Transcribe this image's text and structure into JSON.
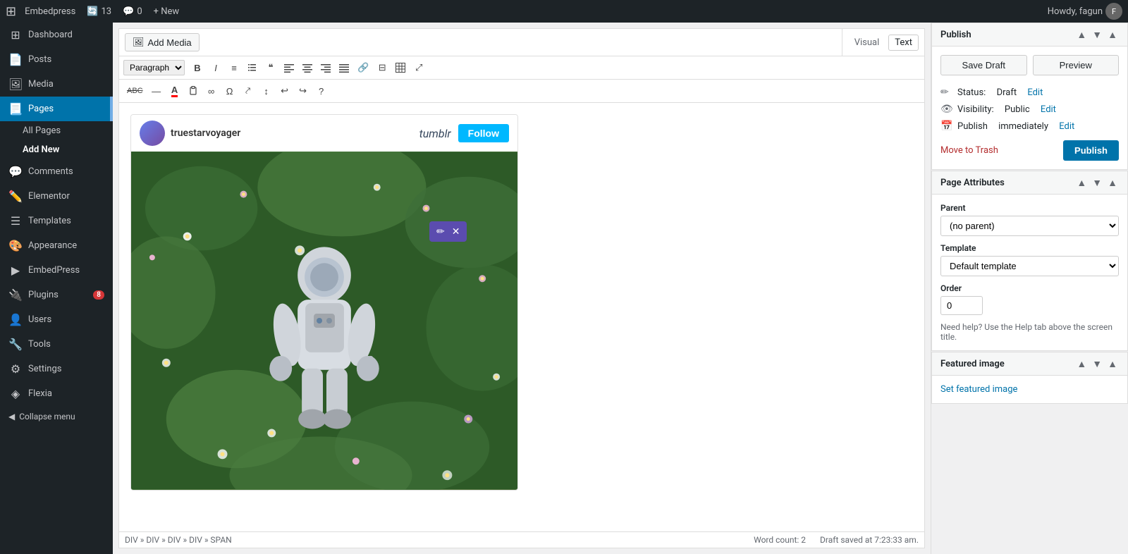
{
  "adminbar": {
    "logo": "⊞",
    "site_name": "Embedpress",
    "updates_count": "13",
    "comments_count": "0",
    "new_label": "+ New",
    "howdy": "Howdy, fagun"
  },
  "sidebar": {
    "items": [
      {
        "id": "dashboard",
        "icon": "⊞",
        "label": "Dashboard"
      },
      {
        "id": "posts",
        "icon": "📄",
        "label": "Posts"
      },
      {
        "id": "media",
        "icon": "🖼",
        "label": "Media"
      },
      {
        "id": "pages",
        "icon": "📃",
        "label": "Pages",
        "active": true
      },
      {
        "id": "comments",
        "icon": "💬",
        "label": "Comments"
      },
      {
        "id": "elementor",
        "icon": "✏️",
        "label": "Elementor"
      },
      {
        "id": "templates",
        "icon": "☰",
        "label": "Templates"
      },
      {
        "id": "appearance",
        "icon": "🎨",
        "label": "Appearance"
      },
      {
        "id": "embedpress",
        "icon": "▶",
        "label": "EmbedPress"
      },
      {
        "id": "plugins",
        "icon": "🔌",
        "label": "Plugins",
        "badge": "8"
      },
      {
        "id": "users",
        "icon": "👤",
        "label": "Users"
      },
      {
        "id": "tools",
        "icon": "🔧",
        "label": "Tools"
      },
      {
        "id": "settings",
        "icon": "⚙",
        "label": "Settings"
      },
      {
        "id": "flexia",
        "icon": "◈",
        "label": "Flexia"
      }
    ],
    "pages_subitems": [
      {
        "label": "All Pages"
      },
      {
        "label": "Add New",
        "active": true
      }
    ],
    "collapse_label": "Collapse menu"
  },
  "editor": {
    "add_media_label": "Add Media",
    "tabs": [
      {
        "id": "visual",
        "label": "Visual"
      },
      {
        "id": "text",
        "label": "Text"
      }
    ],
    "active_tab": "visual",
    "toolbar": {
      "paragraph_select": "Paragraph",
      "buttons": [
        "B",
        "I",
        "≡",
        "≡",
        "❝",
        "≡",
        "≡",
        "≡",
        "🔗",
        "⊟",
        "⊞",
        "⤢"
      ]
    },
    "toolbar2": {
      "buttons": [
        "ABC",
        "—",
        "A",
        "⊞",
        "∞",
        "Ω",
        "⤤",
        "↕",
        "↩",
        "↪",
        "?"
      ]
    }
  },
  "embed": {
    "popup": {
      "edit_icon": "✏",
      "close_icon": "✕"
    },
    "tumblr": {
      "username": "truestarvoyager",
      "brand": "tumblr",
      "follow_label": "Follow"
    }
  },
  "statusbar": {
    "breadcrumb": "DIV » DIV » DIV » DIV » SPAN",
    "word_count": "Word count: 2",
    "draft_saved": "Draft saved at 7:23:33 am."
  },
  "publish_panel": {
    "title": "Publish",
    "save_draft_label": "Save Draft",
    "preview_label": "Preview",
    "status_label": "Status:",
    "status_value": "Draft",
    "status_edit": "Edit",
    "visibility_label": "Visibility:",
    "visibility_value": "Public",
    "visibility_edit": "Edit",
    "publish_label_row": "Publish",
    "publish_timing": "immediately",
    "publish_timing_edit": "Edit",
    "move_to_trash": "Move to Trash",
    "publish_btn": "Publish"
  },
  "page_attributes_panel": {
    "title": "Page Attributes",
    "parent_label": "Parent",
    "parent_placeholder": "(no parent)",
    "template_label": "Template",
    "template_value": "Default template",
    "order_label": "Order",
    "order_value": "0",
    "help_text": "Need help? Use the Help tab above the screen title."
  },
  "featured_image_panel": {
    "title": "Featured image",
    "set_link": "Set featured image"
  }
}
